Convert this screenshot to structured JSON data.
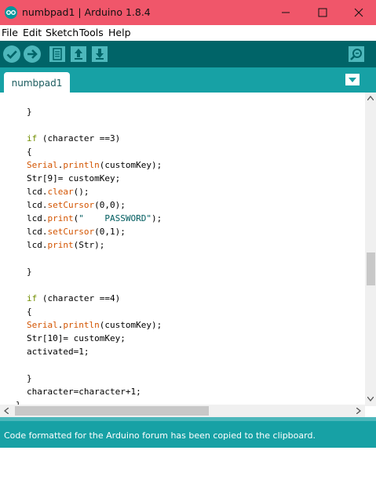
{
  "window": {
    "title": "numbpad1 | Arduino 1.8.4",
    "icon": "arduino-logo-icon"
  },
  "menu": [
    "File",
    "Edit",
    "Sketch",
    "Tools",
    "Help"
  ],
  "toolbar": {
    "buttons": [
      "verify-icon",
      "upload-icon",
      "new-sketch-icon",
      "open-sketch-icon",
      "save-sketch-icon"
    ],
    "serial_monitor": "serial-monitor-icon"
  },
  "tabs": [
    {
      "label": "numbpad1"
    }
  ],
  "editor": {
    "lines": [
      "}",
      "",
      "if (character ==3)",
      "{",
      "Serial.println(customKey);",
      "Str[9]= customKey;",
      "lcd.clear();",
      "lcd.setCursor(0,0);",
      "lcd.print(\"    PASSWORD\");",
      "lcd.setCursor(0,1);",
      "lcd.print(Str);",
      "",
      "}",
      "",
      "if (character ==4)",
      "{",
      "Serial.println(customKey);",
      "Str[10]= customKey;",
      "activated=1;",
      "",
      "}",
      "character=character+1;",
      "}"
    ]
  },
  "scroll": {
    "vertical_position": 0.55,
    "horizontal_thumb_fraction": 0.55
  },
  "status": {
    "message": "Code formatted for the Arduino forum has been copied to the clipboard."
  },
  "colors": {
    "titlebar": "#f0566a",
    "toolbar": "#006468",
    "tabbar": "#17a1a5",
    "status": "#17a1a5",
    "keyword": "#728e00",
    "function": "#d35400",
    "string": "#005c5f"
  }
}
